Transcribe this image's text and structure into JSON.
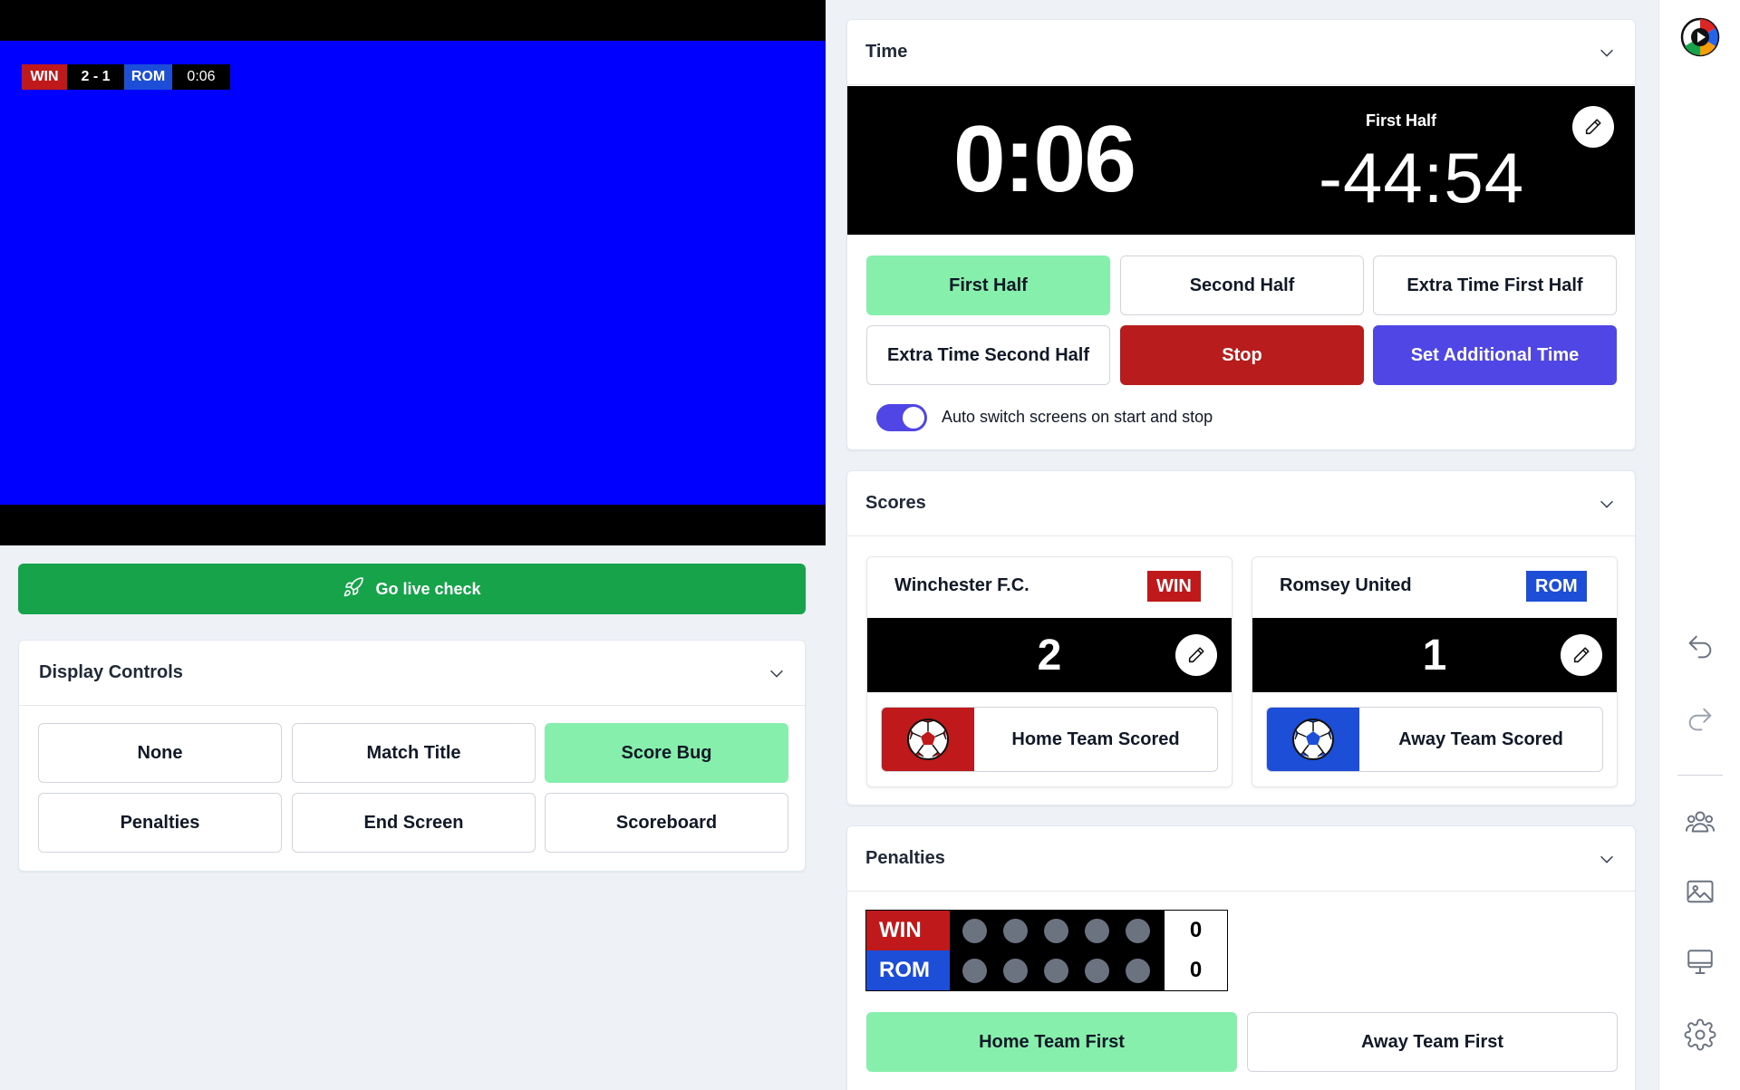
{
  "preview": {
    "bug": {
      "home_code": "WIN",
      "score": "2 - 1",
      "away_code": "ROM",
      "time": "0:06"
    }
  },
  "go_live": {
    "label": "Go live check",
    "icon": "rocket-icon"
  },
  "display_controls": {
    "title": "Display Controls",
    "buttons": [
      "None",
      "Match Title",
      "Score Bug",
      "Penalties",
      "End Screen",
      "Scoreboard"
    ],
    "active": "Score Bug"
  },
  "time": {
    "title": "Time",
    "elapsed": "0:06",
    "period_label": "First Half",
    "remaining": "-44:54",
    "buttons": [
      "First Half",
      "Second Half",
      "Extra Time First Half",
      "Extra Time Second Half",
      "Stop",
      "Set Additional Time"
    ],
    "active": "First Half",
    "auto_switch_label": "Auto switch screens on start and stop",
    "auto_switch_on": true
  },
  "scores": {
    "title": "Scores",
    "home": {
      "name": "Winchester F.C.",
      "code": "WIN",
      "score": "2",
      "scored_label": "Home Team Scored",
      "color": "#c0191c"
    },
    "away": {
      "name": "Romsey United",
      "code": "ROM",
      "score": "1",
      "scored_label": "Away Team Scored",
      "color": "#1d4ed8"
    }
  },
  "penalties": {
    "title": "Penalties",
    "home_code": "WIN",
    "away_code": "ROM",
    "home_total": "0",
    "away_total": "0",
    "home_first_label": "Home Team First",
    "away_first_label": "Away Team First",
    "active": "Home Team First"
  },
  "sidebar": {
    "icons": [
      "app-logo-icon",
      "undo-icon",
      "redo-icon",
      "teams-icon",
      "images-icon",
      "display-icon",
      "settings-icon"
    ]
  },
  "colors": {
    "active_green": "#86efac",
    "go_live_green": "#16a34a",
    "stop_red": "#b91c1c",
    "indigo": "#4f46e5",
    "preview_blue": "#0000ff"
  }
}
